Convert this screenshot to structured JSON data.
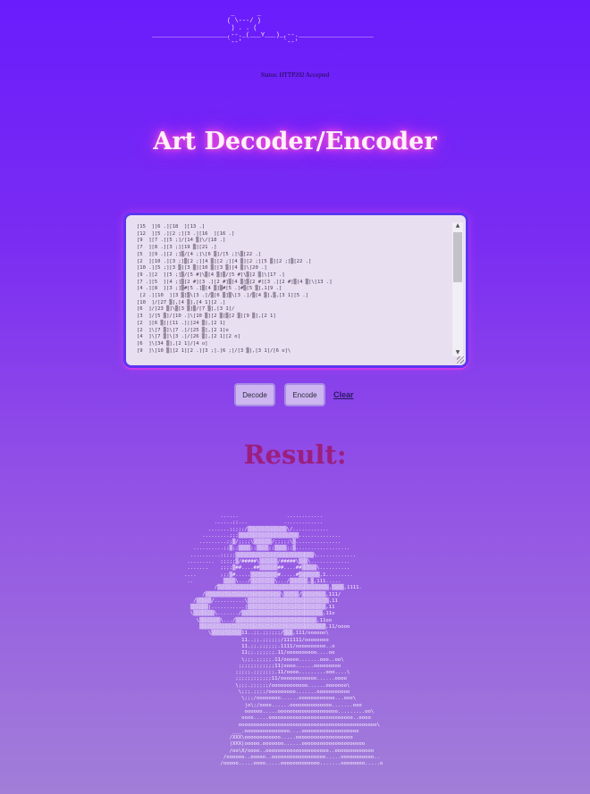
{
  "header": {
    "logo_ascii": "                     _      _\n                    ( \\---/ )\n                     ) . . (\n____________________,--._(___Y___)_,--.____________________\n                    `--'           `--'",
    "status_text": "Status: HTTP202 Accepted"
  },
  "title": "Art Decoder/Encoder",
  "editor": {
    "content": "[15  ][6 .][18  ][13 .]\n[12  ][5 .][2 ;][3 .][16  ][16 .]\n[9  ][7 .][5 ;]/[14 ▒]\\/[18 .]\n[7  ][8 .][3 ;][19 ▒][21 .]\n[5  ][9 .][2 ;]▒/[4 ;]\\[6 ▒]/[5 ;]\\▒[22 .]\n[2  ][10 .][3 ;]▒[2 ;][4 ▒][2 ;][4 ▒][2 ;][5 ▒][2 ;]▒[22 .]\n[10 .][5 ;][3 ▒][3 ▒][10 ▒][3 ▒][4 ▒]\\[20 .]\n[9 .][2  ][5 ;]▒/[5 #]\\▒[4 ▒]▒/[5 #]\\▒[2 ▒]\\[17 .]\n[7 .][5  ][4 ;]▒[2 #][3 .][2 #]▒[4 ▒]▒[2 #][3 .][2 #]▒[4 ▒]\\[13 .]\n[4 .][8  ][3 ;]▒#[5 .]▒[4 ▒]▒#[5 .]#▒[5 ▒],1[9 .]\n [2 .][10  ][3 ▒]▒\\[3 .]/▒[6 ▒]▒\\[3 .]/▒[4 ▒],▒,[3 1][5 .]\n[10  ]/[27 ▒],[4 ▒],[4 1][2 .]\n[6  ]/[23 ▒]\\▒[3 ▒]▒/[7 ▒],[3 1]/\n[3  ]/[5 ▒]/[10 .]\\[10 ▒][2 ▒]▒[2 ▒][9 ▒],[2 1]\n[2  ][6 ▒]|[11 .]|[24 ▒],[2 1]\n[2  ]\\[7 ▒]\\[7 .]/[25 ▒],[2 1]o\n[4  ]\\[7 ▒]\\[3 .]/[26 ▒],[2 1][2 o]\n[6  ]\\[34 ▒],[2 1]/[4 o]\n[9  ]\\[10 ▒][2 1][2 .][3 ;].[6 ;]/[3 ▒],[3 1]/[6 o]\\"
  },
  "buttons": {
    "decode": "Decode",
    "encode": "Encode",
    "clear": "Clear"
  },
  "result_heading": "Result:",
  "result_art": "               ......                ............\n             ......;;...            .............\n           .......;;;;;/▒▒▒▒▒▒▒▒▒▒▒▒▒\\/............\n         .........;;;▒▒▒▒▒▒▒▒▒▒▒▒▒▒▒▒▒▒▒▒..............\n        .........;;▒/;;;;\\▒▒▒▒▒▒/;;;;;\\▒...............\n      ..........;;▒;;▒▒▒▒;;▒▒▒▒;;▒▒▒▒;;▒..................\n     ..........;;;;;▒▒▒▒▒▒▒▒▒▒▒▒▒▒▒▒▒▒▒▒▒▒▒▒▒▒\\.............\n    .........  ;;;;;▒/#####\\▒▒▒▒▒▒/#####\\▒▒▒\\.............\n    .......    ;;;;▒##....##▒▒▒▒▒▒##....##▒▒▒▒▒\\..........\n   ....        ;;;▒#.....▒▒▒▒▒▒▒▒▒#.....#▒▒▒▒▒▒▒,1.........\n    ..          ▒▒▒▒\\.../▒▒▒▒▒▒▒▒\\.../▒▒▒▒▒▒,▒,111.....\n             /▒▒▒▒▒▒▒▒▒▒▒▒▒▒▒▒▒▒▒▒▒▒▒▒▒▒▒▒▒▒▒▒▒▒▒▒▒,▒▒▒▒,1111.\n         /▒▒▒▒▒▒▒▒▒▒▒▒▒▒▒▒▒▒▒▒▒▒▒▒▒\\▒▒▒▒▒/▒▒▒▒▒▒▒▒,111/\n      /▒▒▒▒▒/..........\\▒▒▒▒▒▒▒▒▒▒▒▒▒▒▒▒▒▒▒▒▒▒▒▒▒▒▒,11\n     ▒▒▒▒▒▒|...........|▒▒▒▒▒▒▒▒▒▒▒▒▒▒▒▒▒▒▒▒▒▒▒▒▒▒,11\n     \\▒▒▒▒▒▒▒\\......./▒▒▒▒▒▒▒▒▒▒▒▒▒▒▒▒▒▒▒▒▒▒▒▒▒▒▒,11o\n       \\▒▒▒▒▒▒▒\\.../▒▒▒▒▒▒▒▒▒▒▒▒▒▒▒▒▒▒▒▒▒▒▒▒▒▒▒,11oo\n        ▒▒▒▒▒▒▒▒▒▒▒▒▒▒▒▒▒▒▒▒▒▒▒▒▒▒▒▒▒▒▒▒▒▒▒▒▒▒▒▒▒▒,11/oooo\n           \\▒▒▒▒▒▒▒▒▒▒11..;;.;;;;;;/▒▒▒,111/oooooo\\\n                      11..;;.;;;;;;/111111/oooooooo\n                      11.;;.;;;;;;.1111/oooooooooo..o\n                      11;;.;;;;;;.11/oooooooooo....oo\n                      \\;;;.;;;;;.11/ooooo.......ooo..oo\\\n                     ;;;;;;;;;;;;11|oooo......ooooooooo\n                    ;;;;;.;;;;;;;.11/oooo.........ooo....\\\n                    ;;;;;;;;;;;;11/oooooooooooo......oooo\n                    \\;;;.;;;;;;/oooooooooooo......ooooooo\\\n                     \\;;;.;;;;/ooooooooo.......ooooooooooo\n                      \\;;;/oooooooo......oooooooooooo...ooo\\\n                       |o\\;/oooo......oooooooooooooo.......ooo\n                       oooooo.....oooooooooooooooooooo.........oo\\\n                      oooo.....oooooooooooooooooooooooooooo..oooo\n                     oooooooooooooooooooooooooooooooooooooooooooooo\\\n                   ___.ooooooooooooooo....ooooooooooooooooooo\n                  /XXX\\oooooooooooo.....ooooooooooooooooooo\n                  |XXX|ooooo.ooooooo......ooooooooooooooooooooo\n                  /oo\\X/oooo..ooooooooooooooooooooo..ooooooooooooo\n                /oooooo..ooooo..oooooooooooooooooo.....ooooooooooo..\n               /ooooo.....oooo.....ooooooooooooo.......oooooooo.....o"
}
